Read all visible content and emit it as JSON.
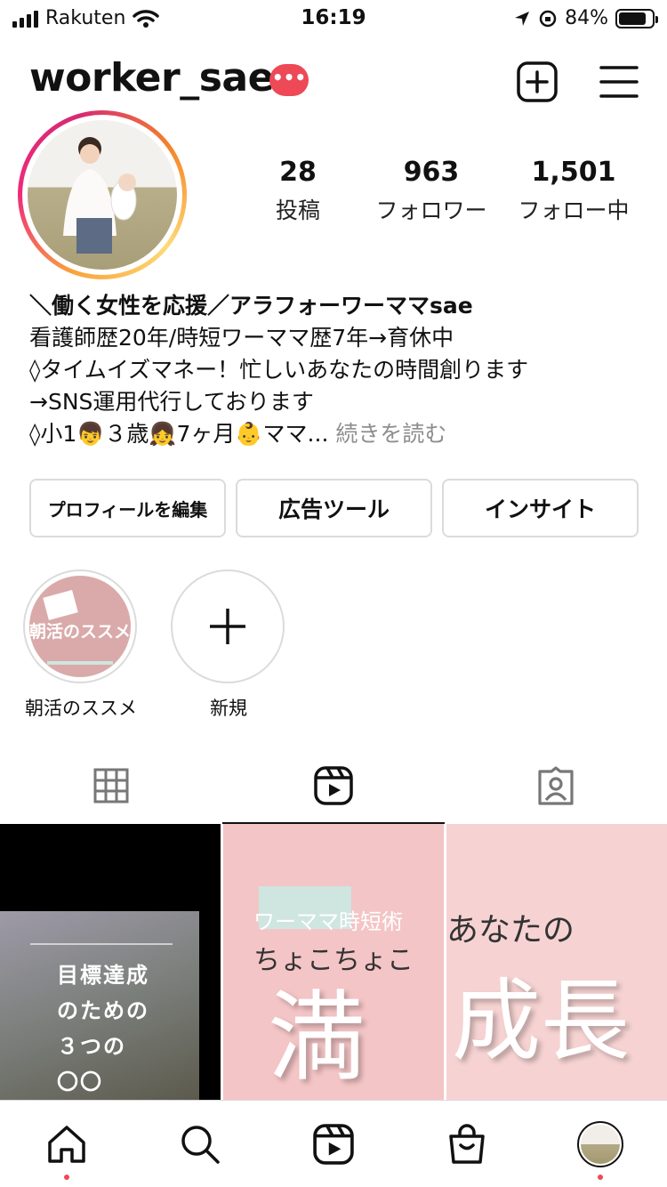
{
  "status_bar": {
    "carrier": "Rakuten",
    "time": "16:19",
    "battery": "84%",
    "battery_level": 0.84
  },
  "header": {
    "username": "worker_sae",
    "badge": "•••",
    "create_icon": "plus-square-icon",
    "menu_icon": "hamburger-menu-icon"
  },
  "profile": {
    "stats": [
      {
        "value": "28",
        "label": "投稿"
      },
      {
        "value": "963",
        "label": "フォロワー"
      },
      {
        "value": "1,501",
        "label": "フォロー中"
      }
    ],
    "bio": {
      "name": "＼働く女性を応援／アラフォーワーママsae",
      "line1": "看護師歴20年/時短ワーママ歴7年→育休中",
      "line2": "◊タイムイズマネー！忙しいあなたの時間創ります",
      "line3": "→SNS運用代行しております",
      "line4": "◊小1👦３歳👧7ヶ月👶ママ...",
      "more": "続きを読む"
    }
  },
  "buttons": {
    "edit": "プロフィールを編集",
    "ads": "広告ツール",
    "insights": "インサイト"
  },
  "highlights": [
    {
      "label": "朝活のススメ",
      "cover_text": "朝活のススメ"
    },
    {
      "label": "新規"
    }
  ],
  "tabs": [
    "grid-icon",
    "reels-icon",
    "tagged-icon"
  ],
  "posts": {
    "p1_text": [
      "目標達成",
      "のための",
      "３つの",
      "〇〇"
    ],
    "p2_small": "ワーママ時短術",
    "p2_line": "ちょこちょこ",
    "p2_big": "満",
    "p3_line": "あなたの",
    "p3_big": "成長"
  },
  "nav": [
    "home-icon",
    "search-icon",
    "reels-icon",
    "shop-icon",
    "profile-avatar"
  ],
  "colors": {
    "badge": "#ed4956",
    "highlight_bg": "#d9aaa9",
    "post_pink": "#f4c5c6"
  }
}
